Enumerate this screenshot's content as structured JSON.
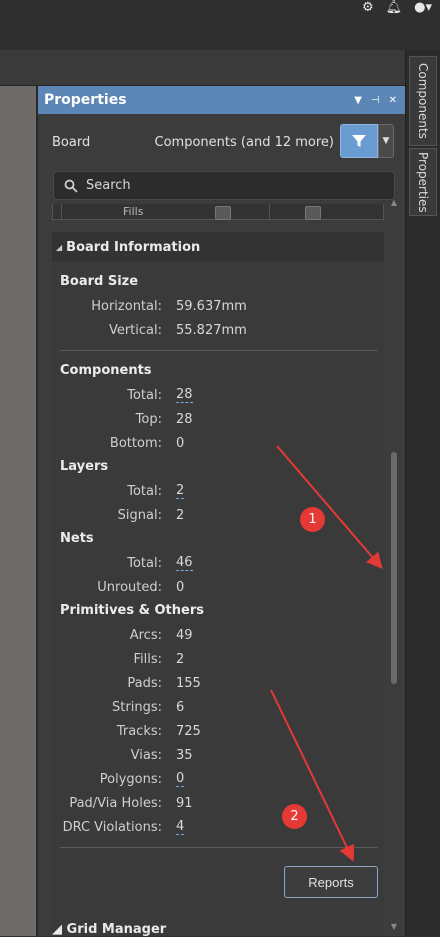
{
  "toolbar": {
    "icons": [
      "gear-icon",
      "bell-icon",
      "user-icon",
      "caret-down-icon"
    ]
  },
  "right_rail": {
    "tabs": [
      "Components",
      "Properties"
    ]
  },
  "panel": {
    "title": "Properties",
    "filter": {
      "object": "Board",
      "components": "Components (and 12 more)"
    },
    "search": {
      "placeholder": "Search"
    },
    "fills_label": "Fills",
    "section_title": "Board Information",
    "board_size": {
      "title": "Board Size",
      "horizontal_label": "Horizontal:",
      "horizontal_value": "59.637mm",
      "vertical_label": "Vertical:",
      "vertical_value": "55.827mm"
    },
    "components": {
      "title": "Components",
      "rows": [
        {
          "k": "Total:",
          "v": "28"
        },
        {
          "k": "Top:",
          "v": "28"
        },
        {
          "k": "Bottom:",
          "v": "0"
        }
      ]
    },
    "layers": {
      "title": "Layers",
      "rows": [
        {
          "k": "Total:",
          "v": "2"
        },
        {
          "k": "Signal:",
          "v": "2"
        }
      ]
    },
    "nets": {
      "title": "Nets",
      "rows": [
        {
          "k": "Total:",
          "v": "46"
        },
        {
          "k": "Unrouted:",
          "v": "0"
        }
      ]
    },
    "primitives": {
      "title": "Primitives & Others",
      "rows": [
        {
          "k": "Arcs:",
          "v": "49"
        },
        {
          "k": "Fills:",
          "v": "2"
        },
        {
          "k": "Pads:",
          "v": "155"
        },
        {
          "k": "Strings:",
          "v": "6"
        },
        {
          "k": "Tracks:",
          "v": "725"
        },
        {
          "k": "Vias:",
          "v": "35"
        },
        {
          "k": "Polygons:",
          "v": "0"
        },
        {
          "k": "Pad/Via Holes:",
          "v": "91"
        },
        {
          "k": "DRC Violations:",
          "v": "4"
        }
      ]
    },
    "reports_label": "Reports",
    "next_section": "Grid Manager"
  },
  "annotations": {
    "badge1": "1",
    "badge2": "2",
    "color": "#e53935"
  }
}
